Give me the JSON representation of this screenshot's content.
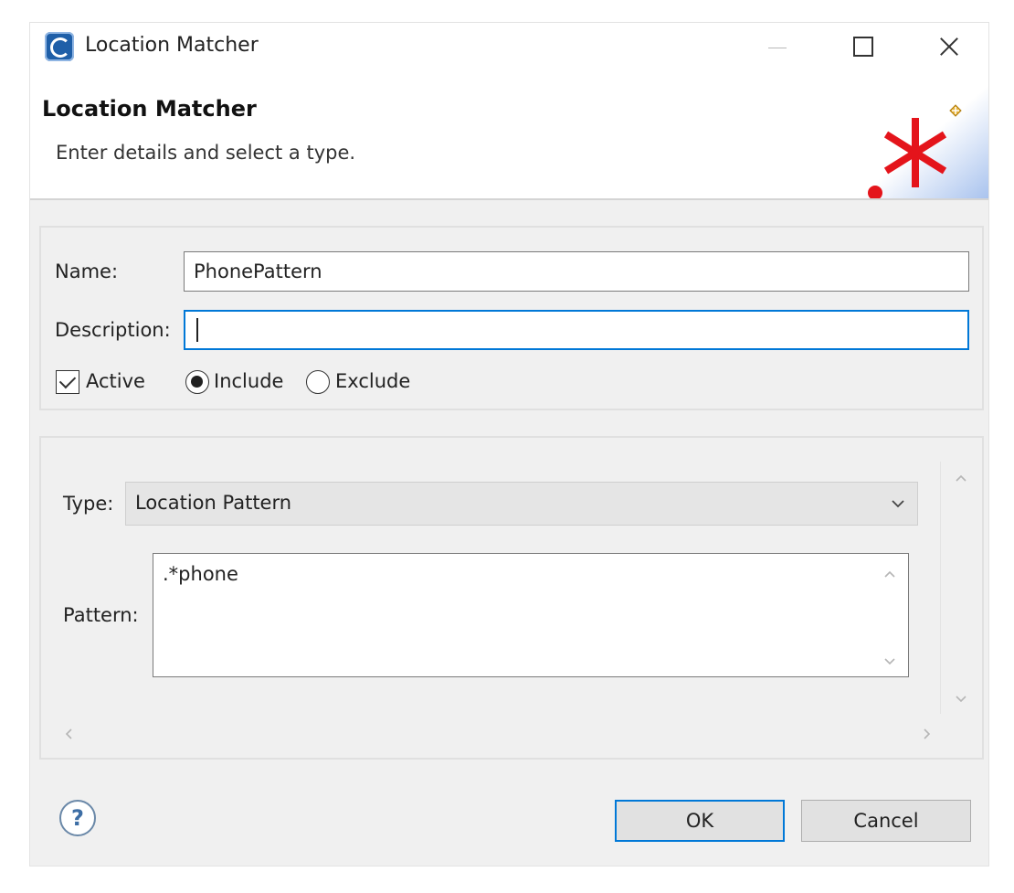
{
  "window": {
    "title": "Location Matcher",
    "icons": {
      "app": "eclipse-app-icon",
      "minimize": "minimize-icon",
      "maximize": "maximize-icon",
      "close": "close-icon"
    }
  },
  "header": {
    "title": "Location Matcher",
    "subtitle": "Enter details and select a type.",
    "banner_icon": "wizard-asterisk-icon"
  },
  "details": {
    "name_label": "Name:",
    "name_value": "PhonePattern",
    "description_label": "Description:",
    "description_value": "",
    "active_label": "Active",
    "active_checked": true,
    "include_label": "Include",
    "exclude_label": "Exclude",
    "selected_mode": "Include"
  },
  "matcher": {
    "type_label": "Type:",
    "type_value": "Location Pattern",
    "pattern_label": "Pattern:",
    "pattern_value": ".*phone"
  },
  "footer": {
    "help_symbol": "?",
    "ok_label": "OK",
    "cancel_label": "Cancel"
  },
  "colors": {
    "accent": "#0078d7",
    "banner_red": "#e4141b",
    "dialog_bg": "#f0f0f0"
  }
}
